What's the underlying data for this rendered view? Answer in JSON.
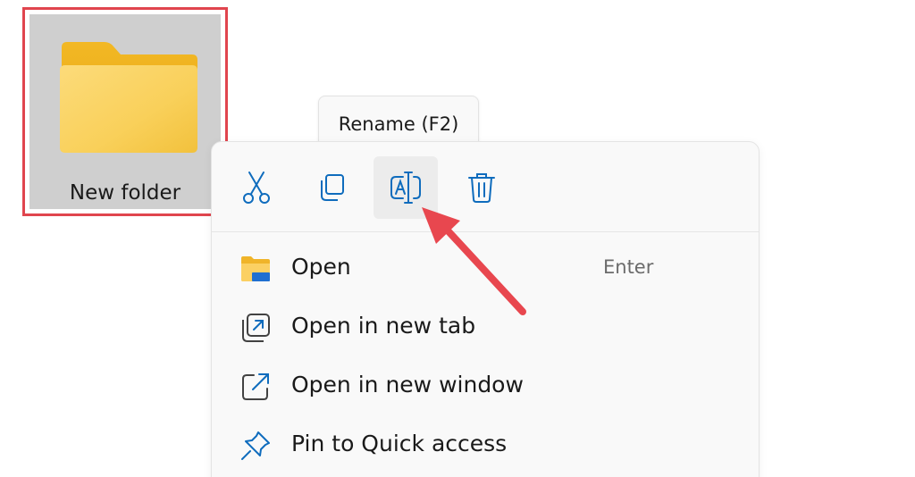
{
  "folder": {
    "label": "New folder",
    "icon": "folder-icon",
    "highlight_color": "#e0454e"
  },
  "tooltip": {
    "text": "Rename (F2)"
  },
  "context_menu": {
    "toolbar": [
      {
        "name": "cut",
        "icon": "scissors-icon"
      },
      {
        "name": "copy",
        "icon": "copy-icon"
      },
      {
        "name": "rename",
        "icon": "rename-icon",
        "active": true
      },
      {
        "name": "delete",
        "icon": "trash-icon"
      }
    ],
    "items": [
      {
        "label": "Open",
        "shortcut": "Enter",
        "icon": "folder-open-icon"
      },
      {
        "label": "Open in new tab",
        "icon": "new-tab-icon"
      },
      {
        "label": "Open in new window",
        "icon": "new-window-icon"
      },
      {
        "label": "Pin to Quick access",
        "icon": "pin-icon"
      }
    ]
  },
  "annotation": {
    "arrow_color": "#e8474f"
  }
}
